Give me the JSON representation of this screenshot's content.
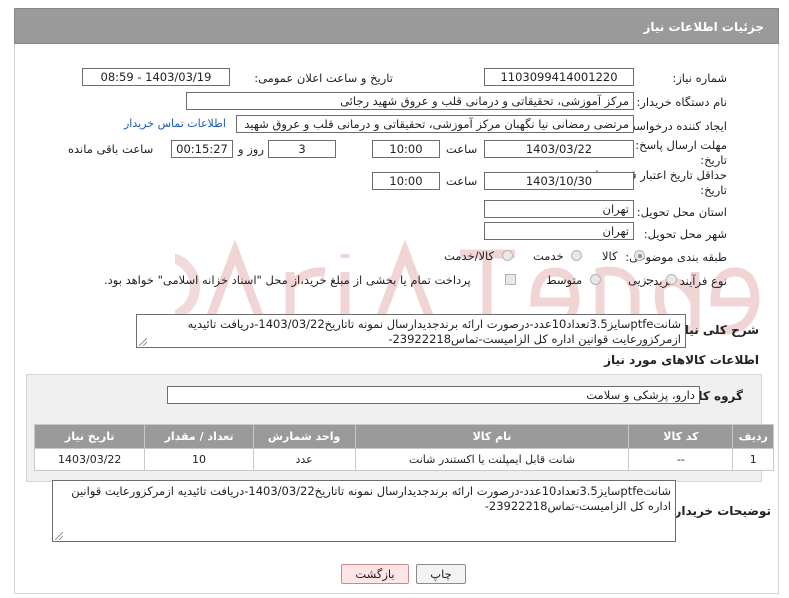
{
  "header": {
    "title": "جزئیات اطلاعات نیاز"
  },
  "form": {
    "need_number": {
      "label": "شماره نیاز:",
      "value": "1103099414001220"
    },
    "announce_datetime": {
      "label": "تاریخ و ساعت اعلان عمومی:",
      "value": "1403/03/19 - 08:59"
    },
    "buyer_org": {
      "label": "نام دستگاه خریدار:",
      "value": "مرکز آموزشی، تحقیقاتی و درمانی قلب و عروق شهید رجائی"
    },
    "requester": {
      "label": "ایجاد کننده درخواست:",
      "value": "مرتضی رمضانی نیا نگهبان مرکز آموزشی، تحقیقاتی و درمانی قلب و عروق شهید",
      "contact_link": "اطلاعات تماس خریدار"
    },
    "deadline": {
      "label_line1": "مهلت ارسال پاسخ: تا",
      "label_line2": "تاریخ:",
      "date": "1403/03/22",
      "time_label": "ساعت",
      "time": "10:00",
      "days": "3",
      "days_label": "روز و",
      "remaining": "00:15:27",
      "remaining_label": "ساعت باقی مانده"
    },
    "price_validity": {
      "label_line1": "حداقل تاریخ اعتبار قیمت: تا",
      "label_line2": "تاریخ:",
      "date": "1403/10/30",
      "time_label": "ساعت",
      "time": "10:00"
    },
    "province": {
      "label": "استان محل تحویل:",
      "value": "تهران"
    },
    "city": {
      "label": "شهر محل تحویل:",
      "value": "تهران"
    },
    "category": {
      "label": "طبقه بندی موضوعی:",
      "options": [
        "کالا",
        "خدمت",
        "کالا/خدمت"
      ],
      "selected": "کالا"
    },
    "purchase_type": {
      "label": "نوع فرآیند خرید :",
      "options": [
        "جزیی",
        "متوسط"
      ],
      "note": "پرداخت تمام یا بخشی از مبلغ خرید،از محل \"اسناد خزانه اسلامی\" خواهد بود."
    }
  },
  "summary": {
    "label": "شرح کلی نیاز:",
    "text": "شانتptfeسایز3.5تعداد10عدد-درصورت ارائه برندجدیدارسال نمونه تاتاریخ1403/03/22-دریافت تائیدیه ازمرکزورعایت قوانین اداره کل الزامیست-تماس23922218-"
  },
  "goods_info": {
    "title": "اطلاعات کالاهای مورد نیاز",
    "group_label": "گروه کالا:",
    "group_value": "دارو، پزشکی و سلامت"
  },
  "table": {
    "headers": [
      "ردیف",
      "کد کالا",
      "نام کالا",
      "واحد شمارش",
      "تعداد / مقدار",
      "تاریخ نیاز"
    ],
    "rows": [
      [
        "1",
        "--",
        "شانت قابل ایمپلنت یا اکستندر شانت",
        "عدد",
        "10",
        "1403/03/22"
      ]
    ]
  },
  "buyer_notes": {
    "label": "توضیحات خریدار:",
    "text": "شانتptfeسایز3.5تعداد10عدد-درصورت ارائه برندجدیدارسال نمونه تاتاریخ1403/03/22-دریافت تائیدیه ازمرکزورعایت قوانین اداره کل الزامیست-تماس23922218-"
  },
  "buttons": {
    "print": "چاپ",
    "back": "بازگشت"
  },
  "colors": {
    "header_bg": "#9a9a9a",
    "link": "#1d59b6",
    "panel_bg": "#f0f0f0",
    "back_button_bg": "#fde5e5"
  }
}
